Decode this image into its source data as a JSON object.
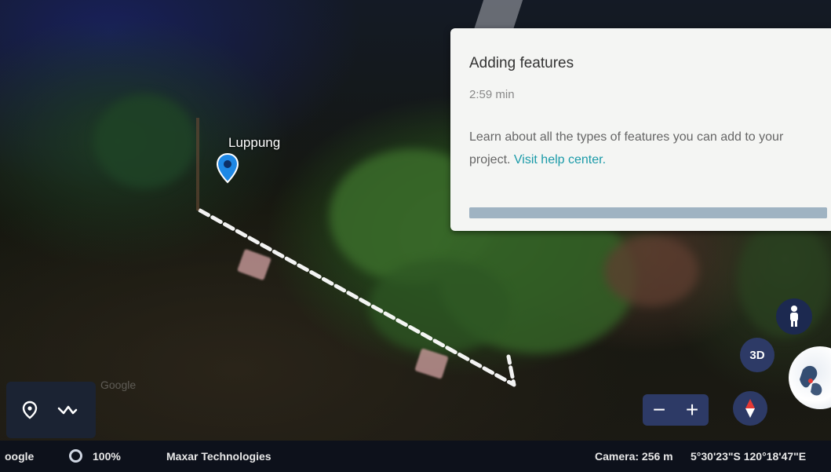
{
  "map": {
    "marker_label": "Luppung",
    "watermark": "Google"
  },
  "help_card": {
    "title": "Adding features",
    "duration": "2:59 min",
    "description": "Learn about all the types of features you can add to your project.",
    "link_text": "Visit help center.",
    "progress": 1.0
  },
  "tools": {
    "placemark_icon": "placemark-icon",
    "path_icon": "line-path-icon"
  },
  "controls": {
    "zoom_out_label": "−",
    "zoom_in_label": "+",
    "view_3d_label": "3D",
    "compass_icon": "compass-icon",
    "pegman_icon": "pegman-icon"
  },
  "status_bar": {
    "google_text": "oogle",
    "load_icon": "ring-icon",
    "percent": "100%",
    "provider": "Maxar Technologies",
    "camera": "Camera: 256 m",
    "coordinates": "5°30'23\"S 120°18'47\"E"
  },
  "colors": {
    "panel_bg": "#1b2333",
    "control_bg": "#2d3a66",
    "link": "#1a9aa8",
    "marker": "#1e88e5"
  }
}
